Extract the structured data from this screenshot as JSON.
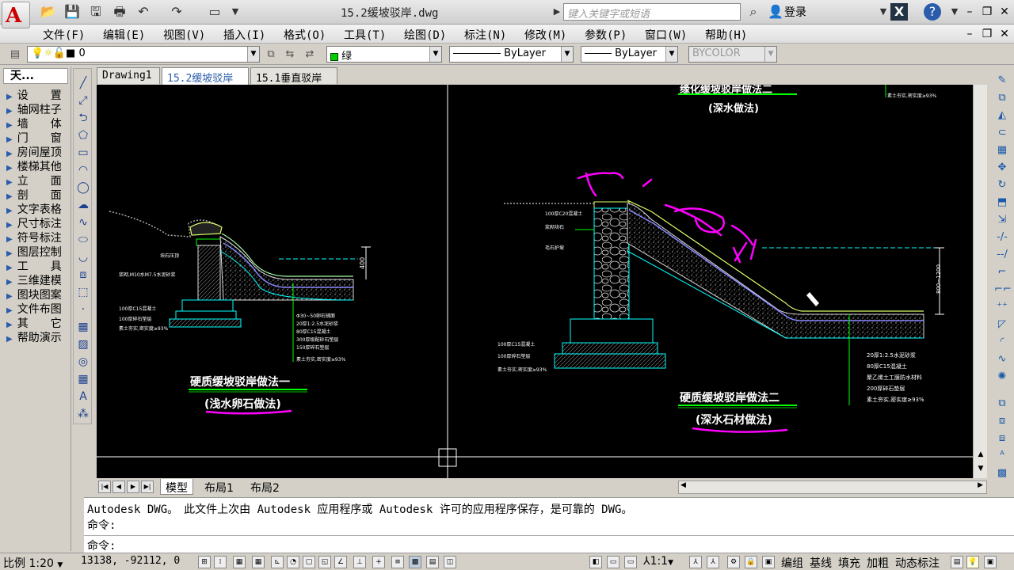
{
  "app": {
    "document_title": "15.2缓坡驳岸.dwg",
    "search_placeholder": "键入关键字或短语",
    "login_label": "登录"
  },
  "menu": [
    "文件(F)",
    "编辑(E)",
    "视图(V)",
    "插入(I)",
    "格式(O)",
    "工具(T)",
    "绘图(D)",
    "标注(N)",
    "修改(M)",
    "参数(P)",
    "窗口(W)",
    "帮助(H)"
  ],
  "toolbar": {
    "layer_value": "0",
    "color_value": "绿",
    "linetype_value": "ByLayer",
    "lineweight_value": "ByLayer",
    "plotstyle_value": "BYCOLOR"
  },
  "left_panel": {
    "title": "天...",
    "items": [
      "设　　置",
      "轴网柱子",
      "墙　　体",
      "门　　窗",
      "房间屋顶",
      "楼梯其他",
      "立　　面",
      "剖　　面",
      "文字表格",
      "尺寸标注",
      "符号标注",
      "图层控制",
      "工　　具",
      "三维建模",
      "图块图案",
      "文件布图",
      "其　　它",
      "帮助演示"
    ]
  },
  "doc_tabs": [
    "Drawing1",
    "15.2缓坡驳岸",
    "15.1垂直驳岸"
  ],
  "layout_tabs": [
    "模型",
    "布局1",
    "布局2"
  ],
  "drawing": {
    "left_title": "硬质缓坡驳岸做法一",
    "left_subtitle": "(浅水卵石做法)",
    "right_title": "硬质缓坡驳岸做法二",
    "right_subtitle": "(深水石材做法)",
    "top_subtitle": "(深水做法)",
    "top_title_partial": "缘化缓坡驳岸做法二",
    "left_dim": "400",
    "right_dim": "800~1200",
    "left_notes": [
      "Φ30~50卵石铺面",
      "20厚1:2.5水泥砂浆",
      "80厚C15混凝土",
      "300厚级配砂石垫层",
      "150厚碎石垫层",
      "素土夯实,密实度≥93%"
    ],
    "left_side_notes": [
      "块石压顶",
      "浆砌,M10水M7.5水泥砂浆",
      "100厚C15混凝土",
      "100厚碎石垫层",
      "素土夯实,密实度≥93%"
    ],
    "right_notes": [
      "20厚1:2.5水泥砂浆",
      "80厚C15混凝土",
      "聚乙烯土工膜防水材料",
      "200厚碎石垫层",
      "素土夯实,密实度≥93%"
    ],
    "right_side_notes": [
      "100厚C20混凝土",
      "浆砌块石",
      "毛石护坡",
      "100厚C15混凝土",
      "100厚碎石垫层",
      "素土夯实,密实度≥93%"
    ],
    "top_right_notes": [
      "素土夯实,密实度≥93%"
    ]
  },
  "command": {
    "message": "Autodesk DWG。　此文件上次由 Autodesk 应用程序或 Autodesk 许可的应用程序保存，是可靠的 DWG。",
    "prompt1": "命令:",
    "prompt2": "命令:"
  },
  "status": {
    "scale": "比例 1:20",
    "coords": "13138, -92112, 0",
    "annotation_scale": "1:1",
    "buttons": [
      "编组",
      "基线",
      "填充",
      "加粗",
      "动态标注"
    ]
  },
  "colors": {
    "canvas": "#000000",
    "drawing_line": "#00ffff",
    "drawing_green": "#00ff00",
    "text_white": "#ffffff",
    "annotation_magenta": "#ff00ff"
  }
}
